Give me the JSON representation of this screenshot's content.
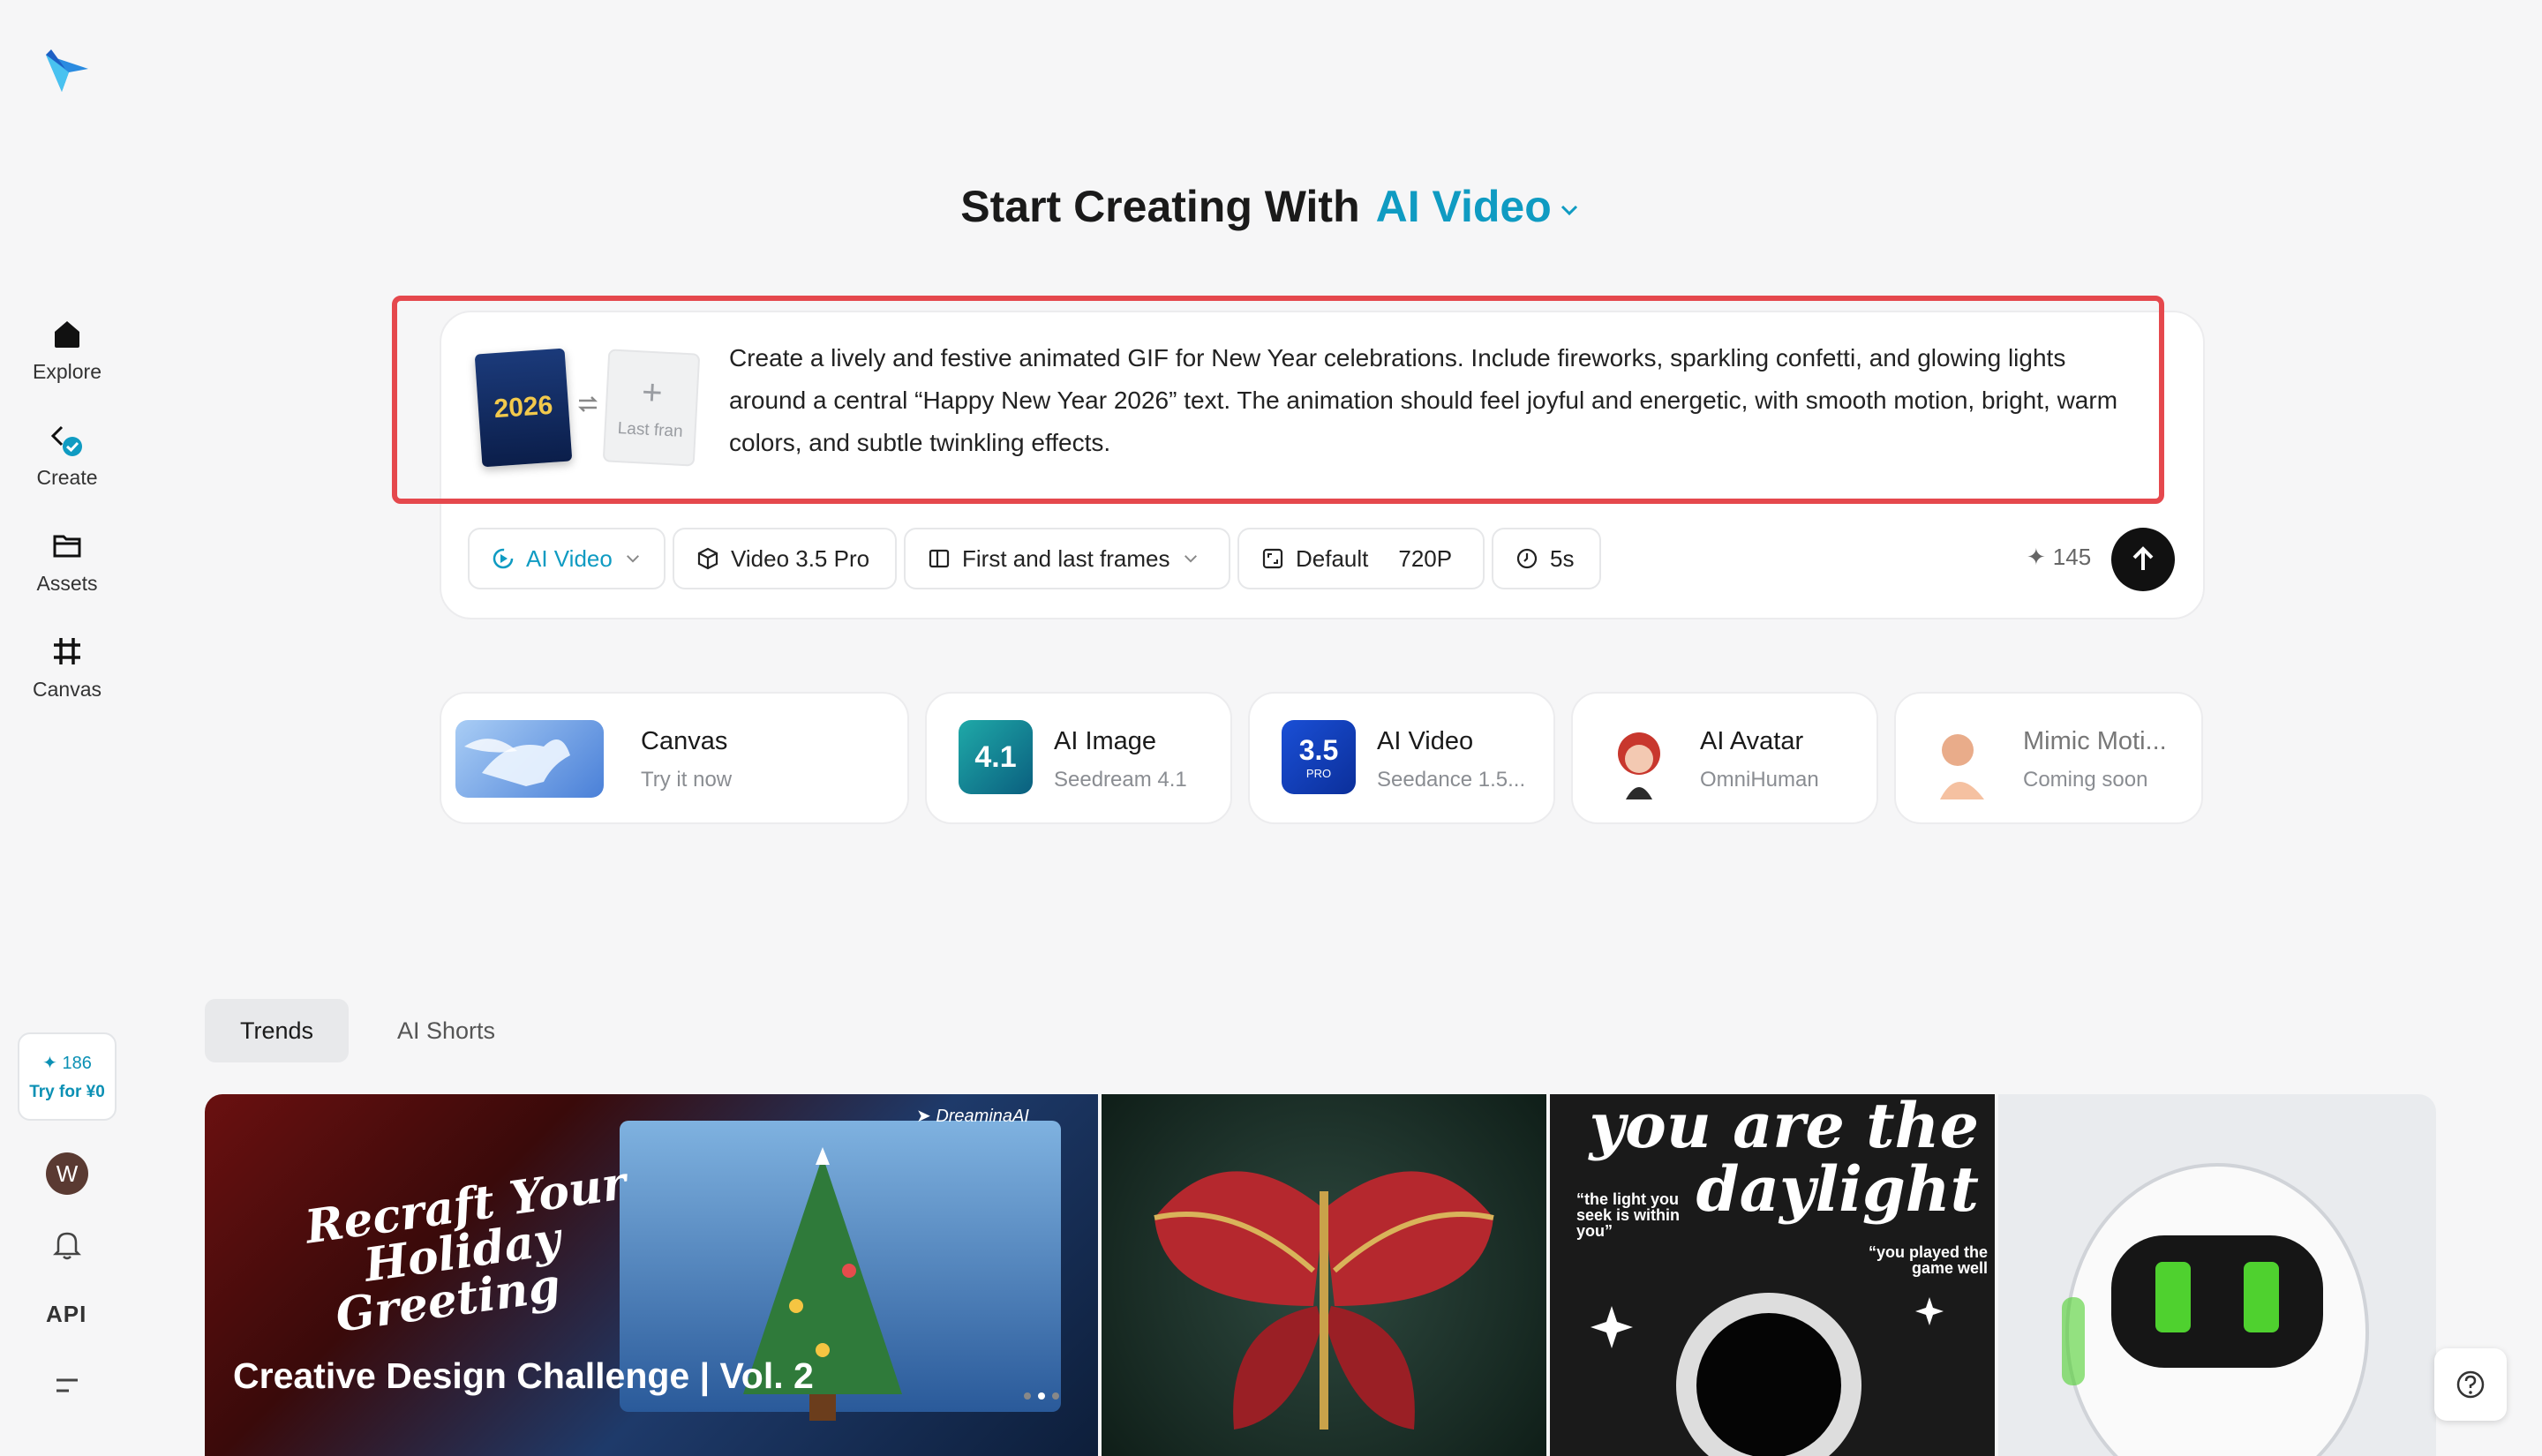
{
  "sidebar": {
    "items": [
      {
        "label": "Explore",
        "icon": "home-icon"
      },
      {
        "label": "Create",
        "icon": "create-icon"
      },
      {
        "label": "Assets",
        "icon": "folder-icon"
      },
      {
        "label": "Canvas",
        "icon": "canvas-icon"
      }
    ],
    "credits": "186",
    "try_label": "Try for ¥0",
    "avatar_initial": "W",
    "api_label": "API"
  },
  "heading": {
    "prefix": "Start Creating With",
    "mode": "AI Video"
  },
  "prompt": {
    "first_frame_text": "2026",
    "last_frame_label": "Last fran",
    "text": "Create a lively and festive animated GIF for New Year celebrations. Include fireworks, sparkling confetti, and glowing lights around a central “Happy New Year 2026” text. The animation should feel joyful and energetic, with smooth motion, bright, warm colors, and subtle twinkling effects."
  },
  "toolbar": {
    "mode": "AI Video",
    "model": "Video 3.5 Pro",
    "frames": "First and last frames",
    "ratio": "Default",
    "resolution": "720P",
    "duration": "5s",
    "cost": "145"
  },
  "cards": [
    {
      "title": "Canvas",
      "subtitle": "Try it now"
    },
    {
      "title": "AI Image",
      "subtitle": "Seedream 4.1",
      "badge": "4.1"
    },
    {
      "title": "AI Video",
      "subtitle": "Seedance 1.5...",
      "badge": "3.5",
      "badge_sub": "PRO"
    },
    {
      "title": "AI Avatar",
      "subtitle": "OmniHuman"
    },
    {
      "title": "Mimic Moti...",
      "subtitle": "Coming soon"
    }
  ],
  "tabs": [
    "Trends",
    "AI Shorts"
  ],
  "gallery": {
    "banner_title": "Creative Design Challenge | Vol. 2",
    "banner_script": [
      "Recraft Your",
      "Holiday",
      "Greeting"
    ],
    "banner_brand": "DreaminaAI",
    "poster_title_1": "you are the",
    "poster_title_2": "daylight",
    "poster_quote_1": "“the light you seek is within you”",
    "poster_quote_2": "“you played the game well"
  },
  "colors": {
    "accent": "#0f9bc2",
    "highlight": "#e5484d"
  }
}
